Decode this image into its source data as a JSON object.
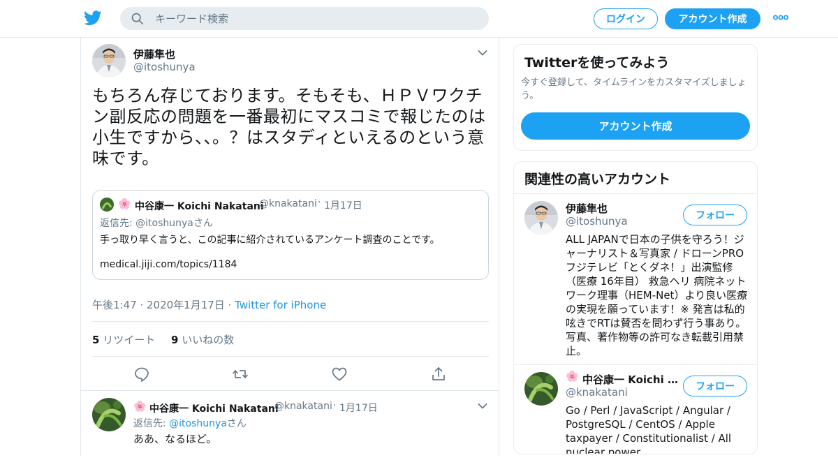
{
  "header": {
    "search_placeholder": "キーワード検索",
    "login_label": "ログイン",
    "signup_label": "アカウント作成",
    "brand_color": "#1da1f2"
  },
  "tweet": {
    "author_name": "伊藤隼也",
    "author_handle": "@itoshunya",
    "text": "もちろん存じております。そもそも、ＨＰＶワクチン副反応の問題を一番最初にマスコミで報じたのは小生ですから、、。？はスタディといえるのという意味です。",
    "quote": {
      "emoji": "🌸",
      "author_name": "中谷康一 Koichi Nakatani",
      "author_handle": "@knakatani",
      "sep": "·",
      "date": "1月17日",
      "reply_to": "返信先: @itoshunyaさん",
      "text": "手っ取り早く言うと、この記事に紹介されているアンケート調査のことです。",
      "link": "medical.jiji.com/topics/1184"
    },
    "timestamp": "午後1:47 · 2020年1月17日 · ",
    "source": "Twitter for iPhone",
    "retweet_count": "5",
    "retweet_label": "リツイート",
    "like_count": "9",
    "like_label": "いいねの数"
  },
  "reply": {
    "emoji": "🌸",
    "author_name": "中谷康一 Koichi Nakatani",
    "author_handle": "@knakatani",
    "sep": "·",
    "date": "1月17日",
    "reply_prefix": "返信先: ",
    "reply_handle": "@itoshunya",
    "reply_suffix": "さん",
    "text": "ああ、なるほど。"
  },
  "signup_card": {
    "title": "Twitterを使ってみよう",
    "description": "今すぐ登録して、タイムラインをカスタマイズしましょう。",
    "button_label": "アカウント作成"
  },
  "related": {
    "title": "関連性の高いアカウント",
    "accounts": [
      {
        "name": "伊藤隼也",
        "handle": "@itoshunya",
        "follow_label": "フォロー",
        "bio": "ALL JAPANで日本の子供を守ろう！ジャーナリスト＆写真家 / ドローンPRO フジテレビ「とくダネ！」出演監修（医療 16年目） 救急ヘリ 病院ネットワーク理事（HEM-Net）より良い医療の実現を願っています！※ 発言は私的呟きでRTは賛否を問わず行う事あり。写真、著作物等の許可なき転載引用禁止。"
      },
      {
        "emoji": "🌸",
        "name": "中谷康一 Koichi …",
        "handle": "@knakatani",
        "follow_label": "フォロー",
        "bio": "Go / Perl / JavaScript / Angular / PostgreSQL / CentOS / Apple taxpayer / Constitutionalist / All nuclear power"
      }
    ]
  }
}
